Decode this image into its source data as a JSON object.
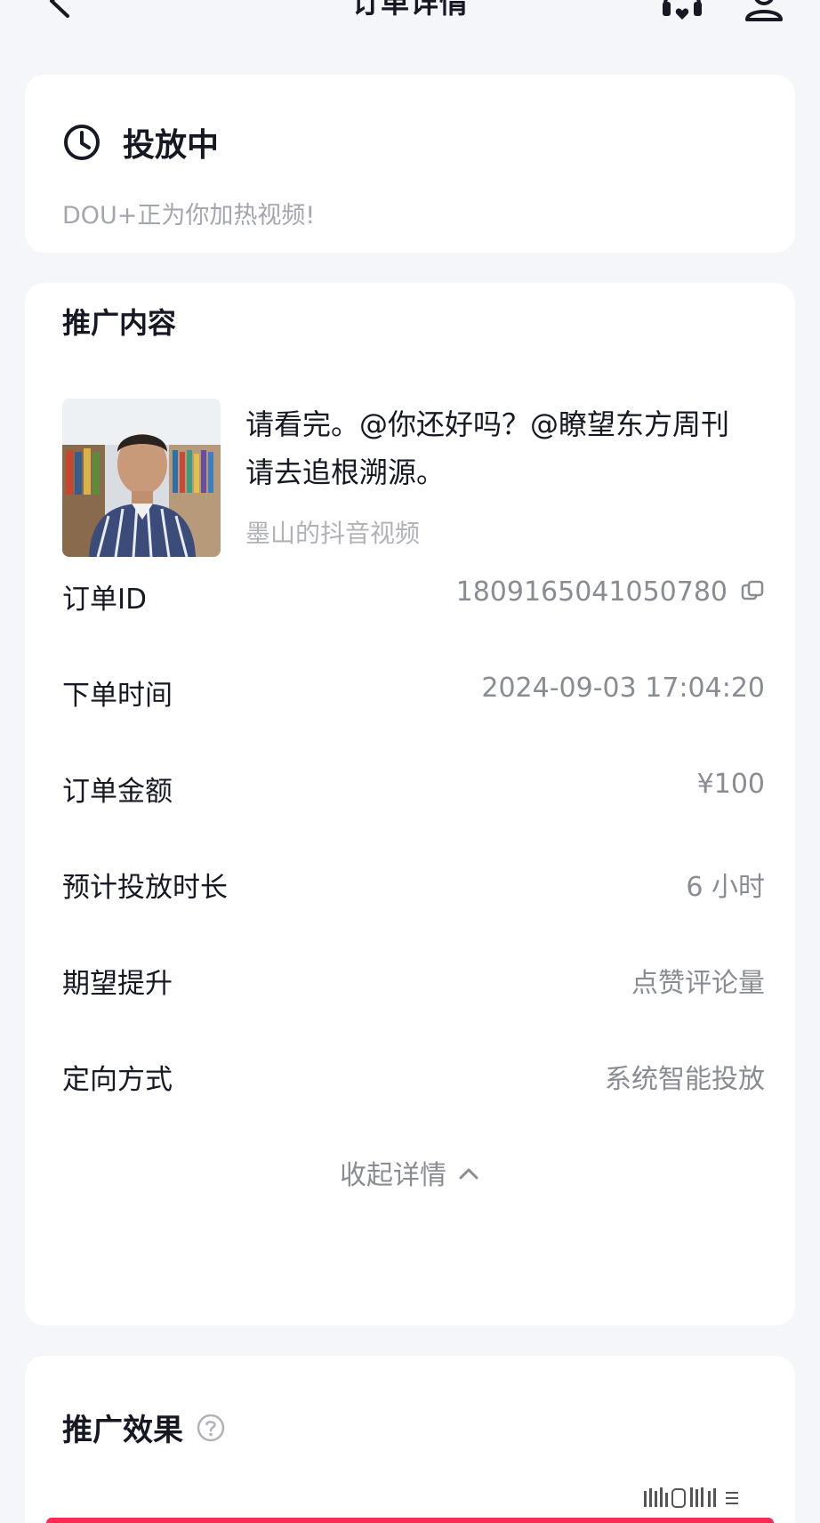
{
  "header": {
    "title": "订单详情",
    "back_icon": "chevron-left-icon",
    "support_icon": "headset-heart-icon",
    "profile_icon": "person-icon"
  },
  "status": {
    "icon": "clock-icon",
    "text": "投放中",
    "subtitle": "DOU+正为你加热视频!"
  },
  "promotion": {
    "section_title": "推广内容",
    "video_title": "请看完。@你还好吗？@瞭望东方周刊 请去追根溯源。",
    "video_source": "墨山的抖音视频"
  },
  "order": {
    "rows": [
      {
        "label": "订单ID",
        "value": "1809165041050780",
        "icon": "copy-icon"
      },
      {
        "label": "下单时间",
        "value": "2024-09-03 17:04:20"
      },
      {
        "label": "订单金额",
        "value": "¥100"
      },
      {
        "label": "预计投放时长",
        "value": "6 小时"
      },
      {
        "label": "期望提升",
        "value": "点赞评论量"
      },
      {
        "label": "定向方式",
        "value": "系统智能投放"
      }
    ],
    "collapse_label": "收起详情"
  },
  "effect": {
    "section_title": "推广效果",
    "help_icon": "question-circle-icon"
  },
  "colors": {
    "background": "#f5f6f9",
    "card": "#ffffff",
    "primary_text": "#161823",
    "secondary_text": "#8a8c93",
    "accent": "#fe2c55"
  }
}
